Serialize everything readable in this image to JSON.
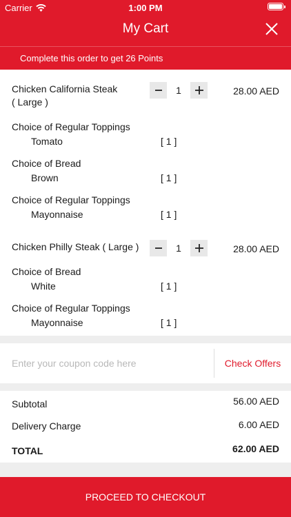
{
  "status_bar": {
    "carrier": "Carrier",
    "time": "1:00 PM"
  },
  "header": {
    "title": "My Cart",
    "points_message": "Complete this order to get 26 Points"
  },
  "cart": {
    "items": [
      {
        "name_line1": "Chicken California Steak",
        "name_line2": "( Large )",
        "quantity": "1",
        "price": "28.00 AED",
        "options": [
          {
            "group": "Choice of Regular Toppings",
            "value": "Tomato",
            "qty": "[ 1 ]"
          },
          {
            "group": "Choice of Bread",
            "value": "Brown",
            "qty": "[ 1 ]"
          },
          {
            "group": "Choice of Regular Toppings",
            "value": "Mayonnaise",
            "qty": "[ 1 ]"
          }
        ]
      },
      {
        "name_line1": "Chicken Philly Steak ( Large )",
        "quantity": "1",
        "price": "28.00 AED",
        "options": [
          {
            "group": "Choice of Bread",
            "value": "White",
            "qty": "[ 1 ]"
          },
          {
            "group": "Choice of Regular Toppings",
            "value": "Mayonnaise",
            "qty": "[ 1 ]"
          }
        ]
      }
    ]
  },
  "coupon": {
    "placeholder": "Enter your coupon code here",
    "check_offers_label": "Check Offers"
  },
  "summary": {
    "subtotal_label": "Subtotal",
    "subtotal_value": "56.00 AED",
    "delivery_label": "Delivery Charge",
    "delivery_value": "6.00 AED",
    "total_label": "TOTAL",
    "total_value": "62.00 AED"
  },
  "checkout_label": "PROCEED TO CHECKOUT",
  "colors": {
    "accent": "#e01a2b",
    "separator": "#eeeeee",
    "stepper_bg": "#e8e8e8"
  },
  "icons": {
    "wifi": "wifi-icon",
    "battery": "battery-icon",
    "close": "close-icon",
    "minus": "minus-icon",
    "plus": "plus-icon"
  }
}
